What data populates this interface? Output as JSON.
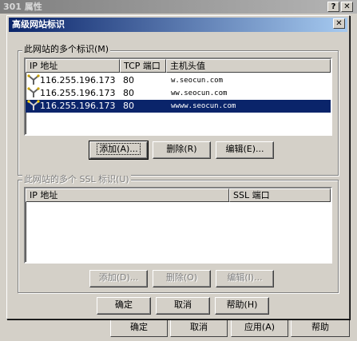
{
  "outer_window": {
    "title": "301 属性",
    "help_btn": "?",
    "close_btn": "✕",
    "buttons": [
      "确定",
      "取消",
      "应用(A)",
      "帮助"
    ]
  },
  "dialog": {
    "title": "高级网站标识",
    "close_btn": "✕",
    "group1": {
      "label": "此网站的多个标识(M)",
      "columns": [
        "IP 地址",
        "TCP 端口",
        "主机头值"
      ],
      "rows": [
        {
          "ip": "116.255.196.173",
          "port": "80",
          "host": "w.seocun.com",
          "selected": false
        },
        {
          "ip": "116.255.196.173",
          "port": "80",
          "host": "ww.seocun.com",
          "selected": false
        },
        {
          "ip": "116.255.196.173",
          "port": "80",
          "host": "wwww.seocun.com",
          "selected": true
        }
      ],
      "add_btn": "添加(A)...",
      "delete_btn": "删除(R)",
      "edit_btn": "编辑(E)..."
    },
    "group2": {
      "label": "此网站的多个 SSL 标识(U)",
      "columns": [
        "IP 地址",
        "SSL 端口"
      ],
      "add_btn": "添加(D)...",
      "delete_btn": "删除(O)",
      "edit_btn": "编辑(I)..."
    },
    "ok_btn": "确定",
    "cancel_btn": "取消",
    "help_btn": "帮助(H)"
  }
}
